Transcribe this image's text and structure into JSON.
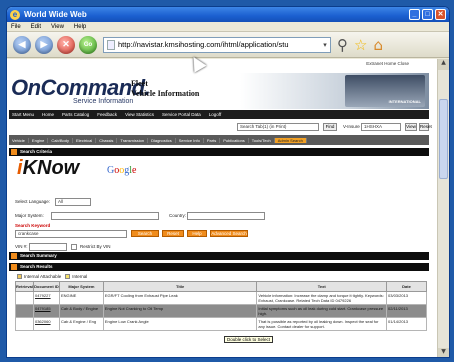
{
  "window": {
    "title": "World Wide Web",
    "min": "_",
    "max": "□",
    "close": "✕"
  },
  "menu": [
    "File",
    "Edit",
    "View",
    "Help"
  ],
  "nav": {
    "back": "◀",
    "forward": "▶",
    "stop": "✕",
    "go": "Go",
    "url": "http://navistar.kmsihosting.com/ihtml/application/stu",
    "dropdown": "▾"
  },
  "toolbar_icons": [
    "magnifier-icon",
    "star-icon",
    "home-icon"
  ],
  "page": {
    "header_links": "Extranet Home    Close",
    "logo": "OnCommand.",
    "logo_sub": "Service Information",
    "fleet_line1": "Fleet",
    "fleet_line2": "Vehicle Information",
    "brand": "INTERNATIONAL",
    "main_nav": [
      "Start Menu",
      "Home",
      "Parts Catalog",
      "Feedback",
      "View Statistics",
      "Service Portal Data",
      "Logoff"
    ],
    "search_select": "Search Tab(1) (in Print)",
    "find_btn": "Find",
    "vin_label": "V-Insure",
    "vin_value": "1HSHXA",
    "view_btn": "View",
    "reset_btn": "Reset",
    "tabs": [
      "Vehicle",
      "Engine",
      "Cab/Body",
      "Electrical",
      "Chassis",
      "Transmission",
      "Diagnostics",
      "Service Info",
      "Parts",
      "Publications",
      "Tools/Tech",
      "Admin Search"
    ],
    "active_tab": "Admin Search",
    "search_criteria": "Search Criteria",
    "iknow_i": "i",
    "iknow_rest": "KNow",
    "google": [
      "G",
      "o",
      "o",
      "g",
      "l",
      "e"
    ],
    "select_language": "Select Language:",
    "language_value": "All",
    "major_system": "Major System:",
    "country": "Country:",
    "search_keyword": "Search Keyword",
    "keyword_value": "crankcase",
    "buttons": [
      "Search",
      "Reset",
      "Help",
      "Advanced Search"
    ],
    "vin": "VIN #:",
    "restrict": "Restrict By VIN",
    "search_summary": "Search Summary",
    "search_results": "Search Results",
    "legend_internal": "Internal Attachable",
    "legend_mine": "Internal",
    "table_headers": [
      "Retrieval",
      "Document ID",
      "Major System",
      "Title",
      "Text",
      "Date"
    ],
    "rows": [
      {
        "id": "0479227",
        "system": "ENGINE",
        "title": "EGR/FT Cooling from Exhaust Pipe Leak",
        "text": "Vehicle information: Increase the clamp and torque it tightly. Keywords: Exhaust, Crankcase. Related Tech Data ID 0479226",
        "date": "03/03/2013"
      },
      {
        "id": "0479185",
        "system": "Cab & Body / Engine",
        "title": "Engine Not Cranking to Oil Temp",
        "text": "Initial symptoms such as oil leak during cold start. Crankcase pressure high.",
        "date": "02/11/2013"
      },
      {
        "id": "0362060",
        "system": "Cab & Engine / Eng",
        "title": "Engine Low Crank Angle",
        "text": "That is possible as reported by oil leaking down. Inspect the seal for any issue. Contact dealer for support.",
        "date": "01/14/2013"
      }
    ],
    "tooltip": "Double click to Select"
  }
}
